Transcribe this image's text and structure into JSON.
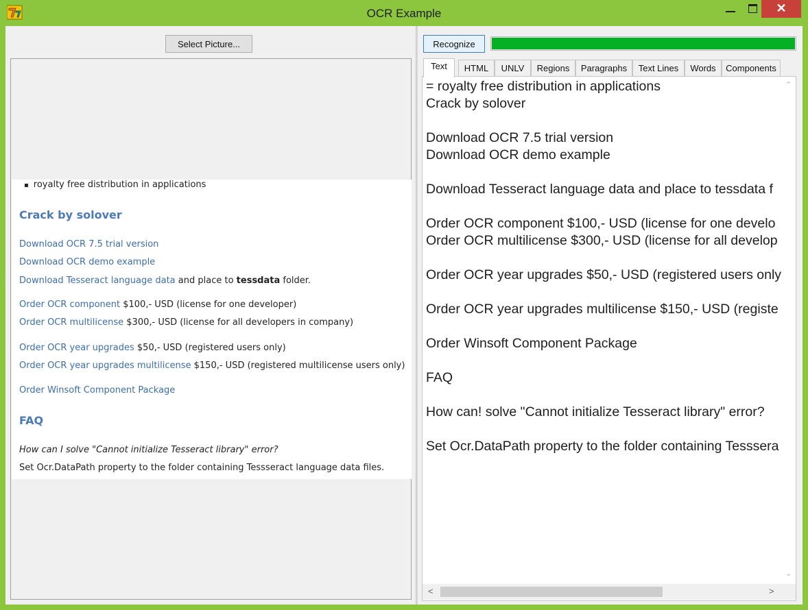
{
  "window": {
    "title": "OCR Example",
    "icons": {
      "app": "delphi-app-icon",
      "minimize": "minimize-icon",
      "maximize": "maximize-icon",
      "close": "close-icon"
    },
    "close_glyph": "✕",
    "colors": {
      "frame": "#8cc63f",
      "close": "#c7413a",
      "progress": "#06b025",
      "link": "#3e6ea8"
    }
  },
  "left": {
    "select_button": "Select Picture...",
    "page": {
      "bullet": "royalty free distribution in applications",
      "heading1": "Crack by solover",
      "link_trial": "Download OCR 7.5 trial version",
      "link_demo": "Download OCR demo example",
      "link_tessdata": "Download Tesseract language data",
      "tessdata_text1": " and place to ",
      "tessdata_bold": "tessdata",
      "tessdata_text2": " folder.",
      "link_component": "Order OCR component",
      "component_price": " $100,- USD (license for one developer)",
      "link_multi": "Order OCR multilicense",
      "multi_price": " $300,- USD (license for all developers in company)",
      "link_upgrades": "Order OCR year upgrades",
      "upgrades_price": " $50,- USD (registered users only)",
      "link_upgrades_multi": "Order OCR year upgrades multilicense",
      "upgrades_multi_price": " $150,- USD (registered multilicense users only)",
      "link_package": "Order Winsoft Component Package",
      "heading2": "FAQ",
      "question": "How can I solve \"Cannot initialize Tesseract library\" error?",
      "answer": "Set Ocr.DataPath property to the folder containing Tessseract language data files."
    }
  },
  "right": {
    "recognize_button": "Recognize",
    "progress": 1.0,
    "tabs": [
      "Text",
      "HTML",
      "UNLV",
      "Regions",
      "Paragraphs",
      "Text Lines",
      "Words",
      "Components"
    ],
    "active_tab": "Text",
    "text_lines": [
      "= royalty free distribution in applications",
      "Crack by solover",
      "",
      "Download OCR 7.5 trial version",
      "Download OCR demo example",
      "",
      "Download Tesseract language data and place to tessdata f",
      "",
      "Order OCR component $100,- USD (license for one develo",
      "Order OCR multilicense $300,- USD (license for all develop",
      "",
      "Order OCR year upgrades $50,- USD (registered users only",
      "",
      "Order OCR year upgrades multilicense $150,- USD (registe",
      "",
      "Order Winsoft Component Package",
      "",
      "FAQ",
      "",
      "How can! solve \"Cannot initialize Tesseract library\" error?",
      "",
      "Set Ocr.DataPath property to the folder containing Tesssera"
    ],
    "scroll_glyphs": {
      "up": "⌃",
      "down": "⌄",
      "left": "<",
      "right": ">"
    }
  }
}
